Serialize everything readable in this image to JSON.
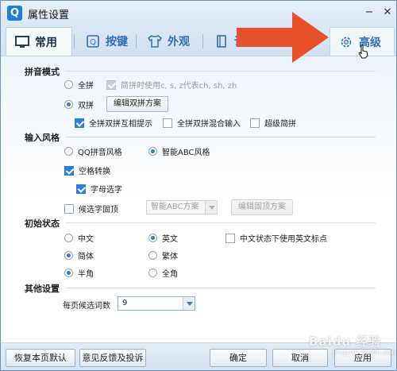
{
  "window": {
    "logo_letter": "Q",
    "title": "属性设置",
    "minimize": "−",
    "close": "✕"
  },
  "tabs": [
    {
      "label": "常用",
      "icon": "monitor-icon",
      "active": true
    },
    {
      "label": "按键",
      "icon": "key-icon",
      "active": false
    },
    {
      "label": "外观",
      "icon": "shirt-icon",
      "active": false
    },
    {
      "label": "词库",
      "icon": "book-icon",
      "active": false
    },
    {
      "label": "高级",
      "icon": "gear-icon",
      "active": false
    }
  ],
  "sections": {
    "pinyin": {
      "title": "拼音模式",
      "full_pinyin": "全拼",
      "full_pinyin_selected": false,
      "simple_pinyin_hint": "简拼时使用c, s, z代表ch, sh, zh",
      "simple_pinyin_hint_checked": true,
      "double_pinyin": "双拼",
      "double_pinyin_selected": true,
      "edit_double_button": "编辑双拼方案",
      "hint_mutual": "全拼双拼互相提示",
      "hint_mutual_checked": true,
      "mixed_input": "全拼双拼混合输入",
      "mixed_input_checked": false,
      "super_simple": "超级简拼",
      "super_simple_checked": false
    },
    "input_style": {
      "title": "输入风格",
      "qq_style": "QQ拼音风格",
      "qq_style_selected": false,
      "abc_style": "智能ABC风格",
      "abc_style_selected": true,
      "space_convert": "空格转换",
      "space_convert_checked": true,
      "letter_select": "字母选字",
      "letter_select_checked": true,
      "candidate_pin": "候选字固顶",
      "candidate_pin_checked": false,
      "scheme_select": "智能ABC方案",
      "edit_pin_button": "编辑固顶方案"
    },
    "initial_state": {
      "title": "初始状态",
      "chinese": "中文",
      "chinese_selected": false,
      "english": "英文",
      "english_selected": true,
      "english_punct": "中文状态下使用英文标点",
      "english_punct_checked": false,
      "simplified": "简体",
      "simplified_selected": true,
      "traditional": "繁体",
      "traditional_selected": false,
      "half_width": "半角",
      "half_width_selected": true,
      "full_width": "全角",
      "full_width_selected": false
    },
    "other": {
      "title": "其他设置",
      "candidates_label": "每页候选词数",
      "candidates_value": "9"
    }
  },
  "footer": {
    "restore_default": "恢复本页默认",
    "feedback": "意见反馈及投诉",
    "ok": "确定",
    "cancel": "取消",
    "apply": "应用"
  },
  "overlay": {
    "watermark": "Baidu 经验",
    "watermark_sub": "jingyan.baidu.com",
    "arrow_color": "#e8502a"
  }
}
